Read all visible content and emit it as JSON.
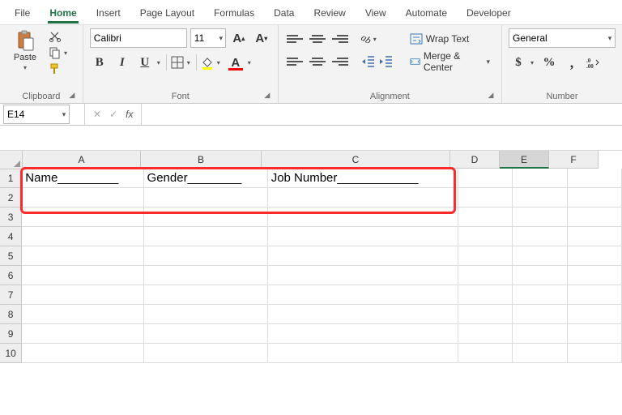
{
  "tabs": {
    "file": "File",
    "home": "Home",
    "insert": "Insert",
    "pagelayout": "Page Layout",
    "formulas": "Formulas",
    "data": "Data",
    "review": "Review",
    "view": "View",
    "automate": "Automate",
    "developer": "Developer"
  },
  "clipboard": {
    "paste": "Paste",
    "group": "Clipboard"
  },
  "font": {
    "name": "Calibri",
    "size": "11",
    "group": "Font"
  },
  "alignment": {
    "wrap": "Wrap Text",
    "merge": "Merge & Center",
    "group": "Alignment"
  },
  "number": {
    "format": "General",
    "group": "Number"
  },
  "namebox": "E14",
  "columns": [
    "A",
    "B",
    "C",
    "D",
    "E",
    "F"
  ],
  "rows": [
    "1",
    "2",
    "3",
    "4",
    "5",
    "6",
    "7",
    "8",
    "9",
    "10"
  ],
  "cells": {
    "A1": "Name_________",
    "B1": "Gender________",
    "C1": "Job Number____________"
  },
  "active_column": "E"
}
